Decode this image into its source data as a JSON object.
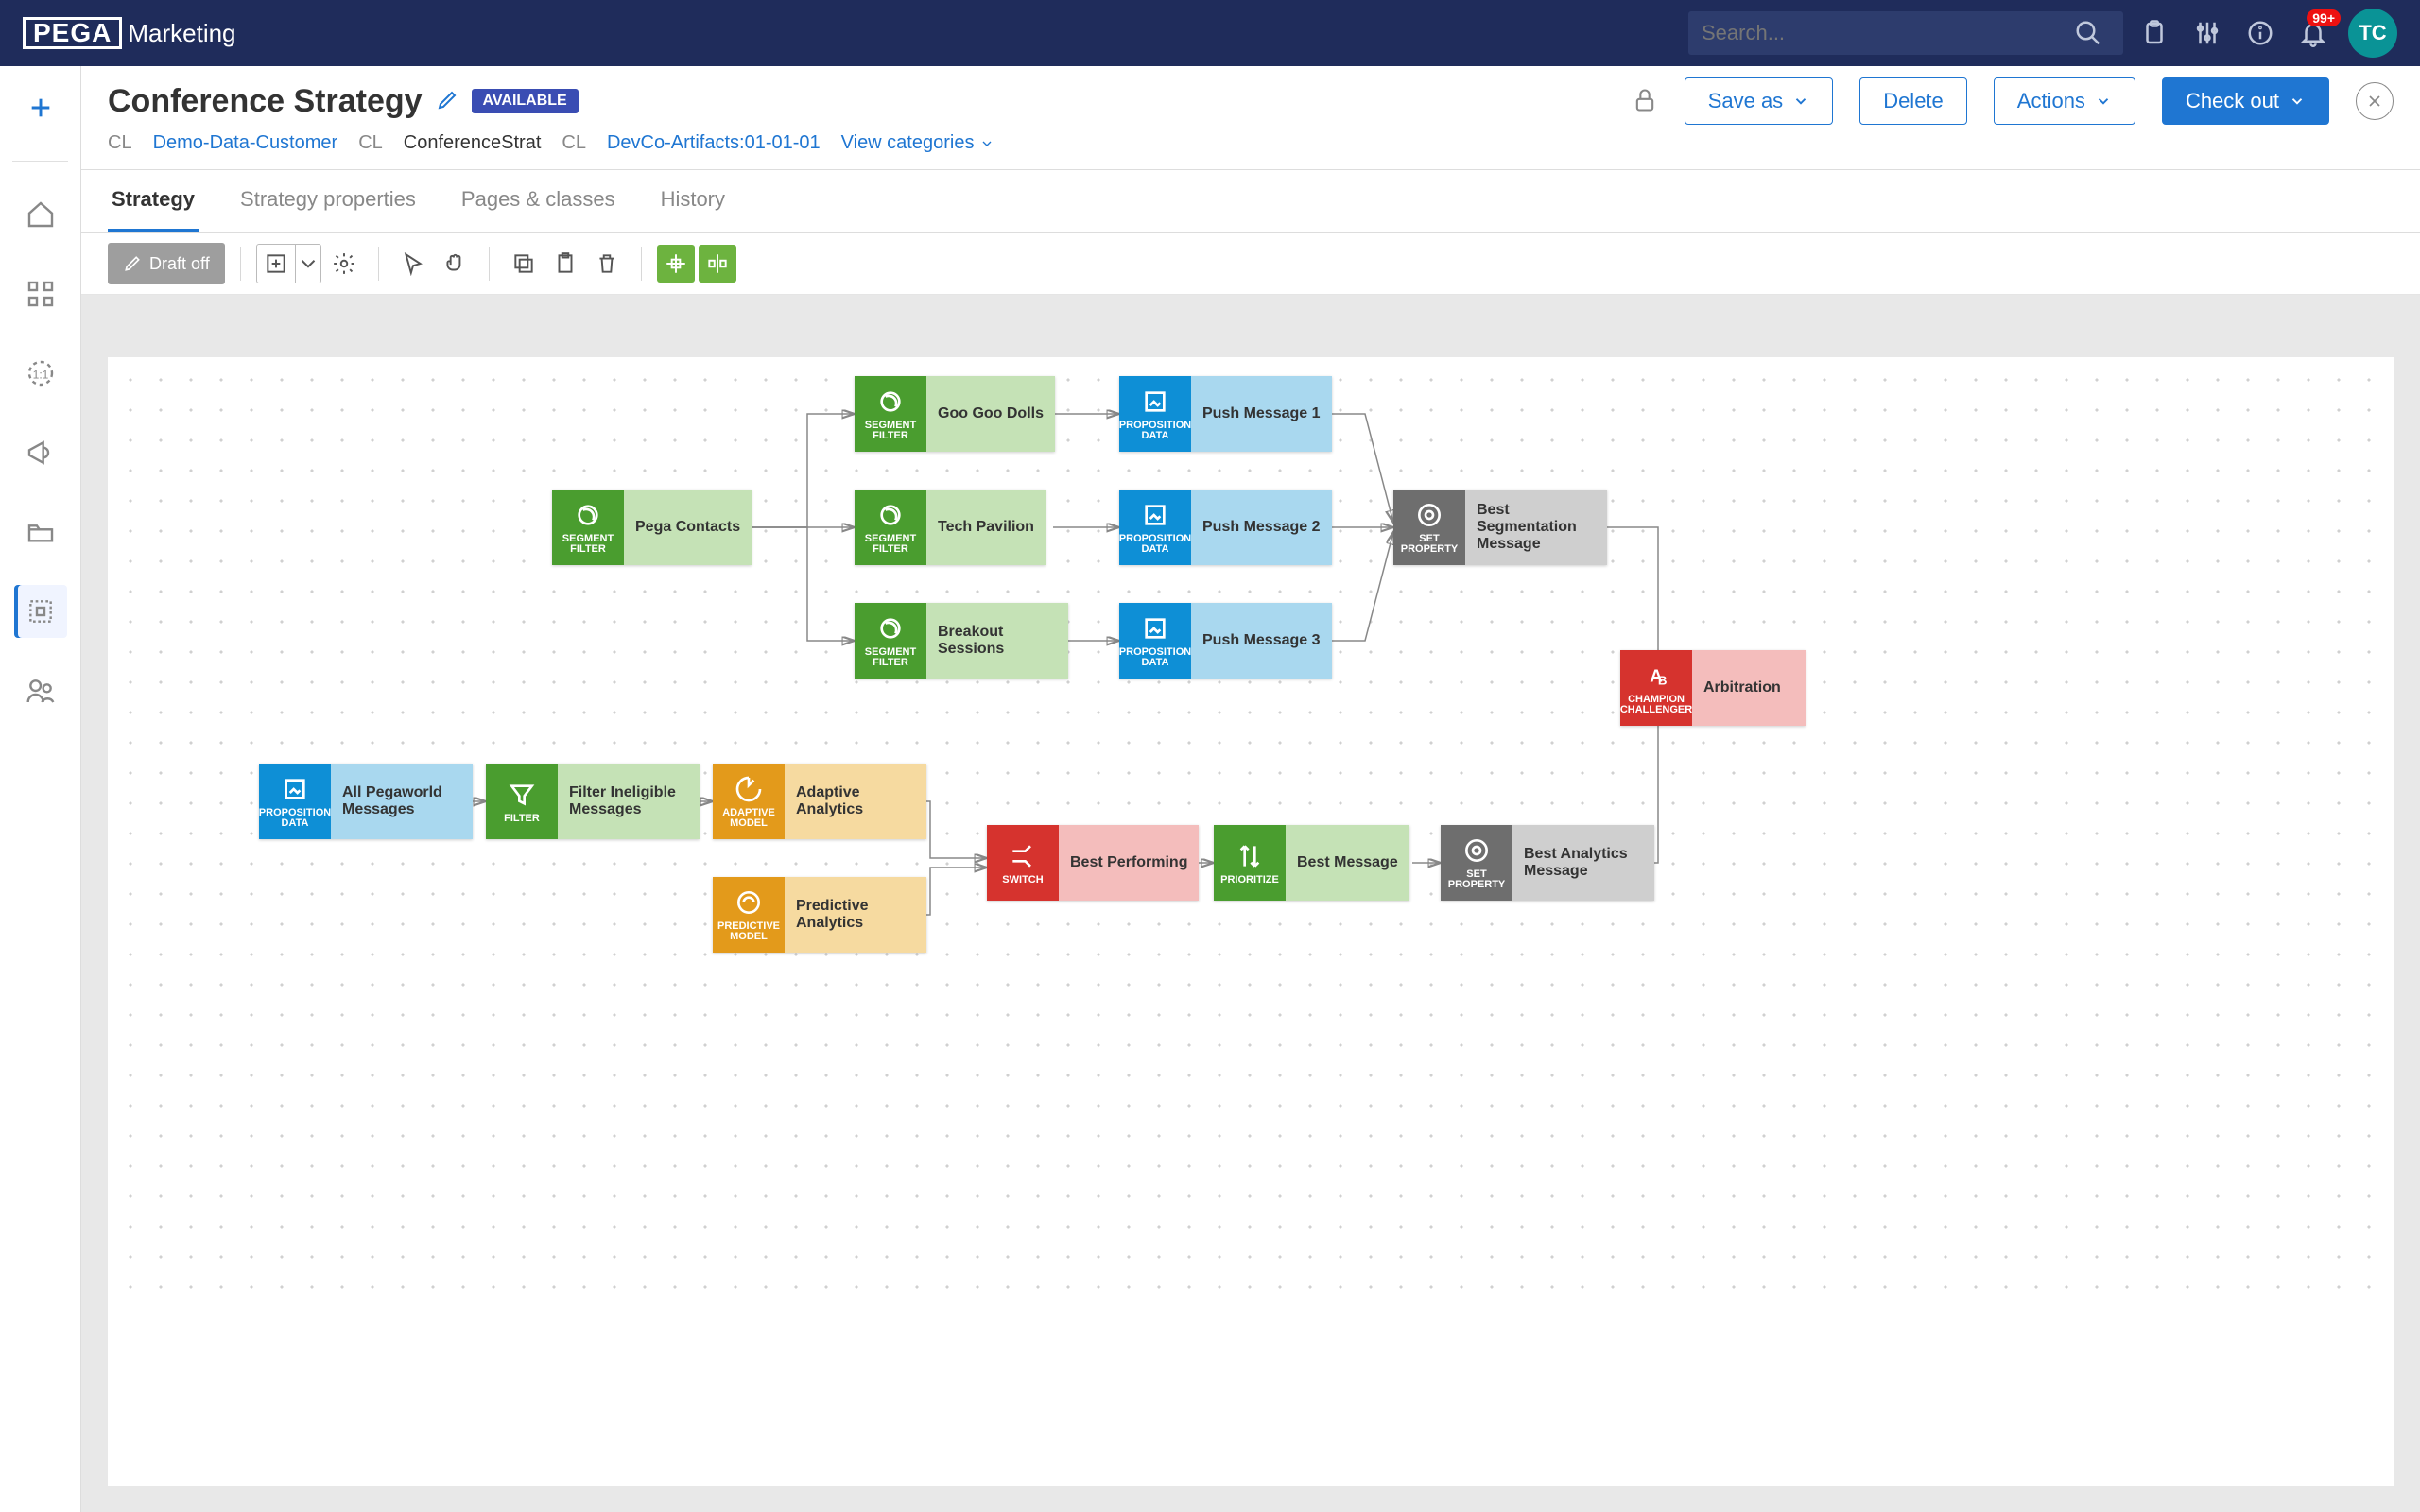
{
  "brand": {
    "logo": "PEGA",
    "product": "Marketing"
  },
  "search": {
    "placeholder": "Search..."
  },
  "notification": {
    "badge": "99+"
  },
  "avatar": {
    "initials": "TC"
  },
  "header": {
    "title": "Conference Strategy",
    "status_badge": "AVAILABLE",
    "breadcrumb": {
      "prefix": "CL",
      "link1": "Demo-Data-Customer",
      "text1": "ConferenceStrat",
      "link2": "DevCo-Artifacts:01-01-01",
      "view_categories": "View categories"
    },
    "buttons": {
      "save_as": "Save as",
      "delete": "Delete",
      "actions": "Actions",
      "check_out": "Check out"
    }
  },
  "tabs": {
    "strategy": "Strategy",
    "properties": "Strategy properties",
    "pages": "Pages & classes",
    "history": "History"
  },
  "toolbar": {
    "draft_off": "Draft off"
  },
  "nodeTypes": {
    "segment": "SEGMENT FILTER",
    "filter": "FILTER",
    "propdata": "PROPOSITION DATA",
    "setprop": "SET PROPERTY",
    "champion": "CHAMPION CHALLENGER",
    "adaptive": "ADAPTIVE MODEL",
    "predictive": "PREDICTIVE MODEL",
    "switch": "SWITCH",
    "prioritize": "PRIORITIZE"
  },
  "nodes": {
    "pega_contacts": "Pega Contacts",
    "goo_goo": "Goo Goo Dolls",
    "tech_pav": "Tech Pavilion",
    "breakout": "Breakout Sessions",
    "push1": "Push Message 1",
    "push2": "Push Message 2",
    "push3": "Push Message 3",
    "best_seg": "Best Segmentation Message",
    "arbitration": "Arbitration",
    "all_pegaworld": "All Pegaworld Messages",
    "filter_inel": "Filter Ineligible Messages",
    "adaptive": "Adaptive Analytics",
    "predictive": "Predictive Analytics",
    "best_perf": "Best Performing",
    "best_msg": "Best Message",
    "best_analytics": "Best Analytics Message"
  }
}
